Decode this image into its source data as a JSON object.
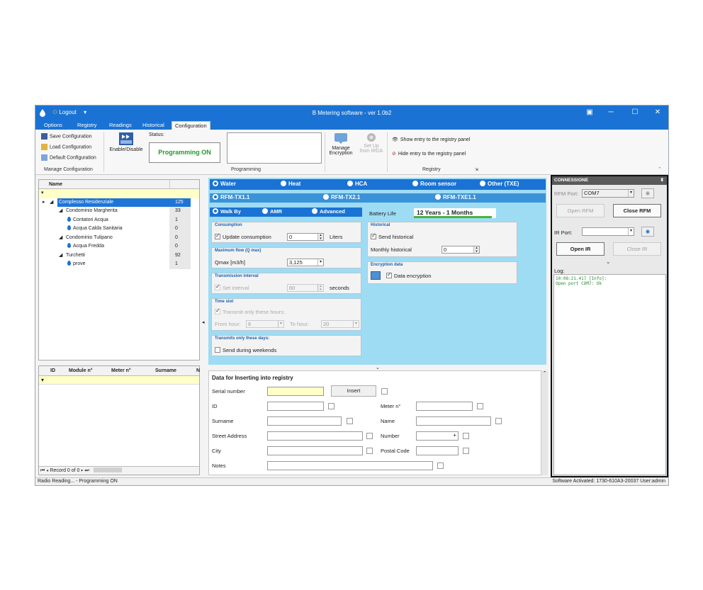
{
  "titlebar": {
    "logout": "Logout",
    "title": "B Metering software - ver 1.0b2",
    "buttons": [
      "▣",
      "─",
      "☐",
      "✕"
    ]
  },
  "tabs": [
    "Options",
    "Registry",
    "Readings",
    "Historical",
    "Configuration"
  ],
  "ribbon": {
    "save_configuration": "Save Configuration",
    "load_configuration": "Load Configuration",
    "default_configuration": "Default Configuration",
    "manage_group": "Manage Configuration",
    "enable_disable": "Enable/Disable",
    "status_label": "Status:",
    "status_value": "Programming ON",
    "programming_group": "Programming",
    "manage_encryption_1": "Manage",
    "manage_encryption_2": "Encryption",
    "setup_irda_1": "Set Up",
    "setup_irda_2": "from IRDA",
    "show_entry": "Show entry to the registry panel",
    "hide_entry": "Hide entry to the registry panel",
    "registry_group": "Registry"
  },
  "tree": {
    "header": "Name",
    "rows": [
      {
        "label": "Complesso Residenziale",
        "count": "125"
      },
      {
        "label": "Condominio Margherita",
        "count": "33"
      },
      {
        "label": "Contatori Acqua",
        "count": "1"
      },
      {
        "label": "Acqua Calda Sanitaria",
        "count": "0"
      },
      {
        "label": "Condominio Tulipano",
        "count": "0"
      },
      {
        "label": "Acqua Fredda",
        "count": "0"
      },
      {
        "label": "Turchetti",
        "count": "92"
      },
      {
        "label": "prove",
        "count": "1"
      }
    ]
  },
  "grid": {
    "columns": [
      "ID",
      "Module n°",
      "Meter n°",
      "Surname",
      "N"
    ],
    "footer": "Record 0 of 0"
  },
  "meter_types": [
    "Water",
    "Heat",
    "HCA",
    "Room sensor",
    "Other (TXE)"
  ],
  "tx_types": [
    "RFM-TX1.1",
    "RFM-TX2.1",
    "RFM-TXE1.1"
  ],
  "modes": [
    "Walk By",
    "AMR",
    "Advanced"
  ],
  "battery": {
    "label": "Battery Life",
    "value": "12 Years - 1 Months",
    "level": 0.95
  },
  "consumption": {
    "title": "Consumption",
    "label": "Update consumption",
    "value": "0",
    "unit": "Liters"
  },
  "max_flow": {
    "title": "Maximum flow (Q max)",
    "label": "Qmax [m3/h]",
    "value": "3,125"
  },
  "transmission": {
    "title": "Transmission interval",
    "label": "Set interval",
    "value": "60",
    "unit": "seconds"
  },
  "time_slot": {
    "title": "Time slot",
    "label": "Transmit only these hours:",
    "from_label": "From hour:",
    "from_value": "6",
    "to_label": "To hour:",
    "to_value": "20"
  },
  "days": {
    "title": "Transmits only these days:",
    "label": "Send during weekends"
  },
  "historical": {
    "title": "Historical",
    "label": "Send historical",
    "monthly_label": "Monthly historical",
    "monthly_value": "0"
  },
  "encryption": {
    "title": "Encryption data",
    "label": "Data encryption"
  },
  "insert": {
    "title": "Data for Inserting into registry",
    "serial": "Serial number",
    "insert_button": "Insert",
    "id": "ID",
    "meter": "Meter n°",
    "surname": "Surname",
    "name": "Name",
    "street": "Street Address",
    "number": "Number",
    "city": "City",
    "postal": "Postal Code",
    "notes": "Notes"
  },
  "connection": {
    "title": "CONNESSIONE",
    "rfm_port_label": "RFM Port:",
    "rfm_port_value": "COM7",
    "open_rfm": "Open RFM",
    "close_rfm": "Close RFM",
    "ir_port_label": "IR Port:",
    "open_ir": "Open IR",
    "close_ir": "Close IR",
    "log_label": "Log:",
    "log_line1": "10:08:21.417 [Info]:",
    "log_line2": "Open port COM7: Ok"
  },
  "statusbar": {
    "left": "Radio Reading... - Programming ON",
    "right": "Software Activated: 1730-610A3-20037   User:admin"
  },
  "colors": {
    "accent": "#1a73d4",
    "panel": "#9edcf4",
    "status_green": "#1e9a2a"
  }
}
